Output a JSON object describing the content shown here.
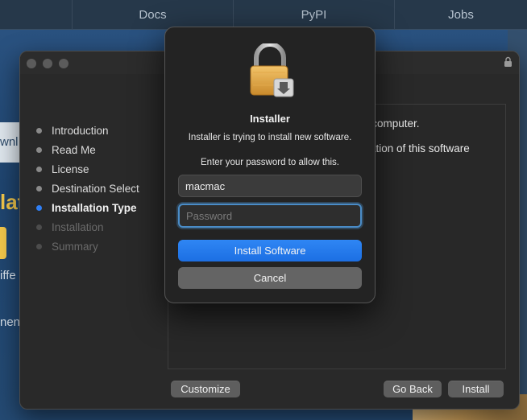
{
  "background_page": {
    "nav_items": [
      "",
      "Docs",
      "PyPI",
      "Jobs"
    ],
    "partial_texts": {
      "left_panel": "wnl",
      "yellow_heading": "lat",
      "line_1": "iffe",
      "line_2": "nent"
    }
  },
  "installer": {
    "steps": [
      {
        "label": "Introduction",
        "state": "done"
      },
      {
        "label": "Read Me",
        "state": "done"
      },
      {
        "label": "License",
        "state": "done"
      },
      {
        "label": "Destination Select",
        "state": "done"
      },
      {
        "label": "Installation Type",
        "state": "active"
      },
      {
        "label": "Installation",
        "state": "disabled"
      },
      {
        "label": "Summary",
        "state": "disabled"
      }
    ],
    "content_lines": [
      "r computer.",
      "llation of this software"
    ],
    "buttons": {
      "customize": "Customize",
      "go_back": "Go Back",
      "install": "Install"
    }
  },
  "auth_dialog": {
    "title": "Installer",
    "message": "Installer is trying to install new software.",
    "prompt": "Enter your password to allow this.",
    "username": "macmac",
    "password_placeholder": "Password",
    "install_button": "Install Software",
    "cancel_button": "Cancel"
  },
  "colors": {
    "accent": "#2f7ff5",
    "focus_ring": "#4a8cc7",
    "window_bg": "#292929"
  }
}
